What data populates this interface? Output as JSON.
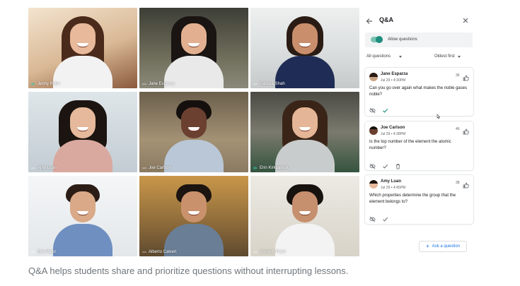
{
  "participants": [
    {
      "name": "Jenny Ritter",
      "mic": "speaking"
    },
    {
      "name": "Jane Esparza",
      "mic": "muted"
    },
    {
      "name": "Parissa Shah",
      "mic": "muted"
    },
    {
      "name": "Amy Luan",
      "mic": "muted"
    },
    {
      "name": "Joe Carlson",
      "mic": "muted"
    },
    {
      "name": "Erin Kirkpatrick",
      "mic": "speaking"
    },
    {
      "name": "Erik Patel",
      "mic": "muted"
    },
    {
      "name": "Alberto Calvert",
      "mic": "muted"
    },
    {
      "name": "Vishesh Patel",
      "mic": "muted"
    }
  ],
  "panel": {
    "title": "Q&A",
    "allow_label": "Allow questions",
    "filter_label": "All questions",
    "sort_label": "Oldest first",
    "ask_label": "Ask a question",
    "accent": "#1e8e7e"
  },
  "questions": [
    {
      "author": "Jane Esparza",
      "time": "Jul 29 • 4:30PM",
      "votes": "36",
      "text": "Can you go over again what makes the noble gases noble?"
    },
    {
      "author": "Joe Carlson",
      "time": "Jul 29 • 4:38PM",
      "votes": "46",
      "text": "Is the top number of the element the atomic number?"
    },
    {
      "author": "Amy Luan",
      "time": "Jul 29 • 4:45PM",
      "votes": "38",
      "text": "Which properties determine the group that the element belongs to?"
    }
  ],
  "caption": "Q&A helps students share and prioritize questions without interrupting lessons."
}
